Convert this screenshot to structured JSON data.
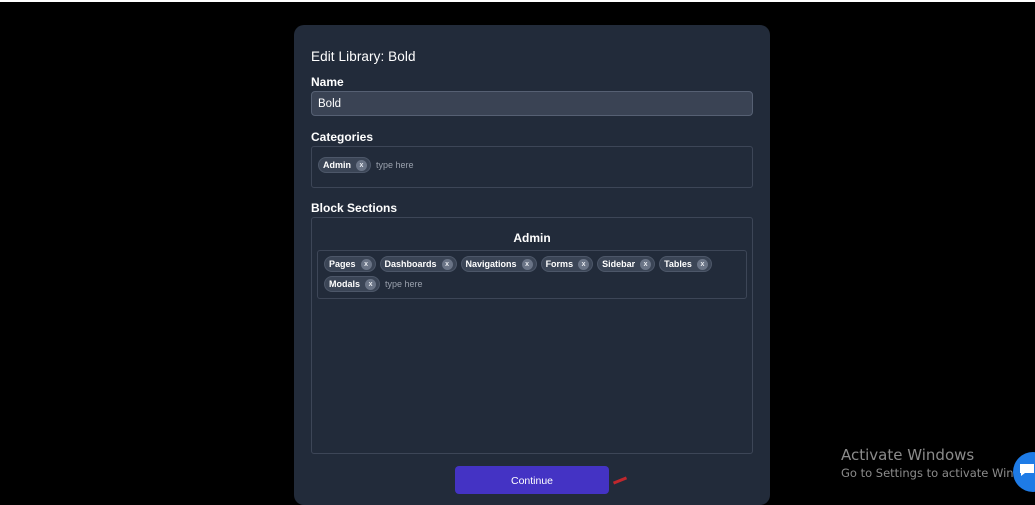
{
  "modal": {
    "title": "Edit Library: Bold",
    "name_label": "Name",
    "name_value": "Bold",
    "categories_label": "Categories",
    "categories": [
      {
        "label": "Admin",
        "remove": "x"
      }
    ],
    "categories_placeholder": "type here",
    "block_sections_label": "Block Sections",
    "section": {
      "title": "Admin",
      "tags": [
        {
          "label": "Pages",
          "remove": "x"
        },
        {
          "label": "Dashboards",
          "remove": "x"
        },
        {
          "label": "Navigations",
          "remove": "x"
        },
        {
          "label": "Forms",
          "remove": "x"
        },
        {
          "label": "Sidebar",
          "remove": "x"
        },
        {
          "label": "Tables",
          "remove": "x"
        },
        {
          "label": "Modals",
          "remove": "x"
        }
      ],
      "placeholder": "type here"
    },
    "continue_label": "Continue"
  },
  "watermark": {
    "title": "Activate Windows",
    "subtitle": "Go to Settings to activate Windows."
  },
  "colors": {
    "modal_bg": "#222b3a",
    "accent": "#4433c4",
    "chat": "#1e7be6"
  },
  "icons": {
    "chat": "chat-bubble-icon"
  }
}
